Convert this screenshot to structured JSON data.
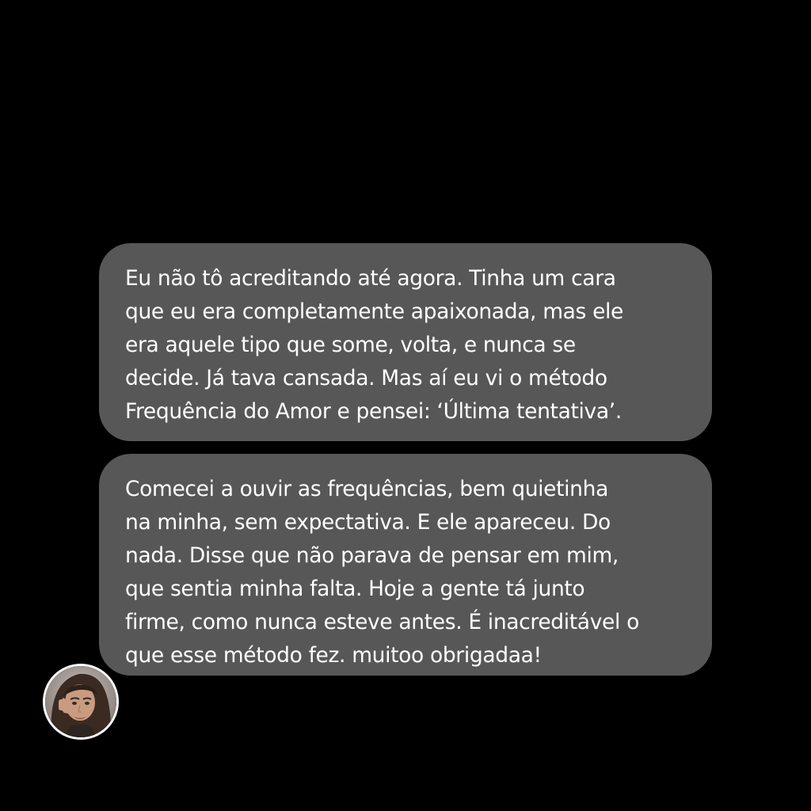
{
  "messages": [
    {
      "text": "Eu não tô acreditando até agora. Tinha um cara\nque eu era completamente apaixonada, mas ele\nera aquele tipo que some, volta, e nunca se\ndecide. Já tava cansada. Mas aí eu vi o método\nFrequência do Amor e pensei: ‘Última tentativa’."
    },
    {
      "text": " Comecei a ouvir as frequências, bem quietinha\nna minha, sem expectativa. E ele apareceu. Do\nnada. Disse que não parava de pensar em mim,\nque sentia minha falta. Hoje a gente tá junto\nfirme, como nunca esteve antes. É inacreditável o\nque esse método fez.  muitoo obrigadaa!"
    }
  ],
  "colors": {
    "background": "#000000",
    "bubble": "#575757",
    "text": "#ffffff"
  }
}
